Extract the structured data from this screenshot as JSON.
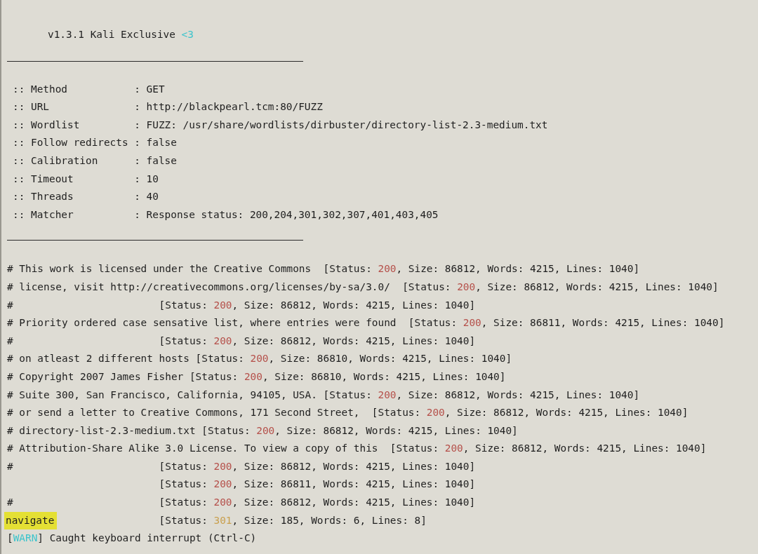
{
  "banner": {
    "text": "v1.3.1 Kali Exclusive",
    "heart": "<3"
  },
  "settings": [
    {
      "label": ":: Method",
      "value": ": GET"
    },
    {
      "label": ":: URL",
      "value": ": http://blackpearl.tcm:80/FUZZ"
    },
    {
      "label": ":: Wordlist",
      "value": ": FUZZ: /usr/share/wordlists/dirbuster/directory-list-2.3-medium.txt"
    },
    {
      "label": ":: Follow redirects",
      "value": ": false"
    },
    {
      "label": ":: Calibration",
      "value": ": false"
    },
    {
      "label": ":: Timeout",
      "value": ": 10"
    },
    {
      "label": ":: Threads",
      "value": ": 40"
    },
    {
      "label": ":: Matcher",
      "value": ": Response status: 200,204,301,302,307,401,403,405"
    }
  ],
  "results": [
    {
      "word": "# This work is licensed under the Creative Commons ",
      "prefix": "[Status:",
      "status": "200",
      "color": "#b5504a",
      "details": ", Size: 86812, Words: 4215, Lines: 1040]",
      "highlighted": false
    },
    {
      "word": "# license, visit http://creativecommons.org/licenses/by-sa/3.0/ ",
      "prefix": "[Status:",
      "status": "200",
      "color": "#b5504a",
      "details": ", Size: 86812, Words: 4215, Lines: 1040]",
      "highlighted": false
    },
    {
      "word": "#",
      "prefix": "[Status:",
      "status": "200",
      "color": "#b5504a",
      "details": ", Size: 86812, Words: 4215, Lines: 1040]",
      "highlighted": false
    },
    {
      "word": "# Priority ordered case sensative list, where entries were found ",
      "prefix": "[Status:",
      "status": "200",
      "color": "#b5504a",
      "details": ", Size: 86811, Words: 4215, Lines: 1040]",
      "highlighted": false
    },
    {
      "word": "#",
      "prefix": "[Status:",
      "status": "200",
      "color": "#b5504a",
      "details": ", Size: 86812, Words: 4215, Lines: 1040]",
      "highlighted": false
    },
    {
      "word": "# on atleast 2 different hosts",
      "prefix": "[Status:",
      "status": "200",
      "color": "#b5504a",
      "details": ", Size: 86810, Words: 4215, Lines: 1040]",
      "highlighted": false
    },
    {
      "word": "# Copyright 2007 James Fisher",
      "prefix": "[Status:",
      "status": "200",
      "color": "#b5504a",
      "details": ", Size: 86810, Words: 4215, Lines: 1040]",
      "highlighted": false
    },
    {
      "word": "# Suite 300, San Francisco, California, 94105, USA.",
      "prefix": "[Status:",
      "status": "200",
      "color": "#b5504a",
      "details": ", Size: 86812, Words: 4215, Lines: 1040]",
      "highlighted": false
    },
    {
      "word": "# or send a letter to Creative Commons, 171 Second Street, ",
      "prefix": "[Status:",
      "status": "200",
      "color": "#b5504a",
      "details": ", Size: 86812, Words: 4215, Lines: 1040]",
      "highlighted": false
    },
    {
      "word": "# directory-list-2.3-medium.txt",
      "prefix": "[Status:",
      "status": "200",
      "color": "#b5504a",
      "details": ", Size: 86812, Words: 4215, Lines: 1040]",
      "highlighted": false
    },
    {
      "word": "# Attribution-Share Alike 3.0 License. To view a copy of this ",
      "prefix": "[Status:",
      "status": "200",
      "color": "#b5504a",
      "details": ", Size: 86812, Words: 4215, Lines: 1040]",
      "highlighted": false
    },
    {
      "word": "#",
      "prefix": "[Status:",
      "status": "200",
      "color": "#b5504a",
      "details": ", Size: 86812, Words: 4215, Lines: 1040]",
      "highlighted": false
    },
    {
      "prefix": "[Status:",
      "status": "200",
      "color": "#b5504a",
      "details": ", Size: 86811, Words: 4215, Lines: 1040]",
      "highlighted": false
    },
    {
      "word": "#",
      "prefix": "[Status:",
      "status": "200",
      "color": "#b5504a",
      "details": ", Size: 86812, Words: 4215, Lines: 1040]",
      "highlighted": false
    },
    {
      "word": "navigate",
      "prefix": "[Status:",
      "status": "301",
      "color": "#c9a04e",
      "details": ", Size: 185, Words: 6, Lines: 8]",
      "highlighted": true
    }
  ],
  "warning": {
    "open": "[",
    "tag": "WARN",
    "close": "]",
    "message": "Caught keyboard interrupt (Ctrl-C)"
  }
}
